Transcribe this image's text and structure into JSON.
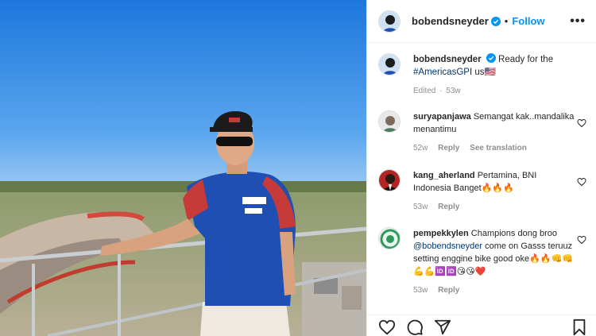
{
  "post": {
    "username": "bobendsneyder",
    "follow_label": "Follow",
    "more_label": "•••",
    "separator": "•"
  },
  "caption": {
    "username": "bobendsneyder",
    "text_before": "Ready for the",
    "hashtag": "#AmericasGP",
    "text_after": "I us",
    "emoji": "🇺🇸",
    "edited": "Edited",
    "sep": "·",
    "age": "53w"
  },
  "comments": [
    {
      "username": "suryapanjawa",
      "text": "Semangat kak..mandalika menantimu",
      "age": "52w",
      "reply": "Reply",
      "translate": "See translation"
    },
    {
      "username": "kang_aherland",
      "text": "Pertamina, BNI Indonesia Banget🔥🔥🔥",
      "age": "53w",
      "reply": "Reply"
    },
    {
      "username": "pempekkylen",
      "text_before": "Champions dong broo",
      "mention": "@bobendsneyder",
      "text_after": "come on Gasss teruuz setting enggine bike good oke🔥🔥👊👊💪💪🆔🆔😘😘❤️",
      "age": "53w",
      "reply": "Reply"
    }
  ],
  "photo": {
    "jersey_brand_1": "PERTAMINA",
    "jersey_brand_2": "BNI"
  },
  "icons": {
    "verified": "verified-badge-icon",
    "heart": "heart-icon",
    "comment": "comment-icon",
    "share": "share-icon",
    "save": "bookmark-icon",
    "more": "more-icon"
  },
  "colors": {
    "accent": "#0095f6",
    "verified": "#0095f6",
    "link": "#00376b",
    "meta": "#8e8e8e",
    "sky": "#2f86e0",
    "jersey": "#1f4fb3"
  }
}
